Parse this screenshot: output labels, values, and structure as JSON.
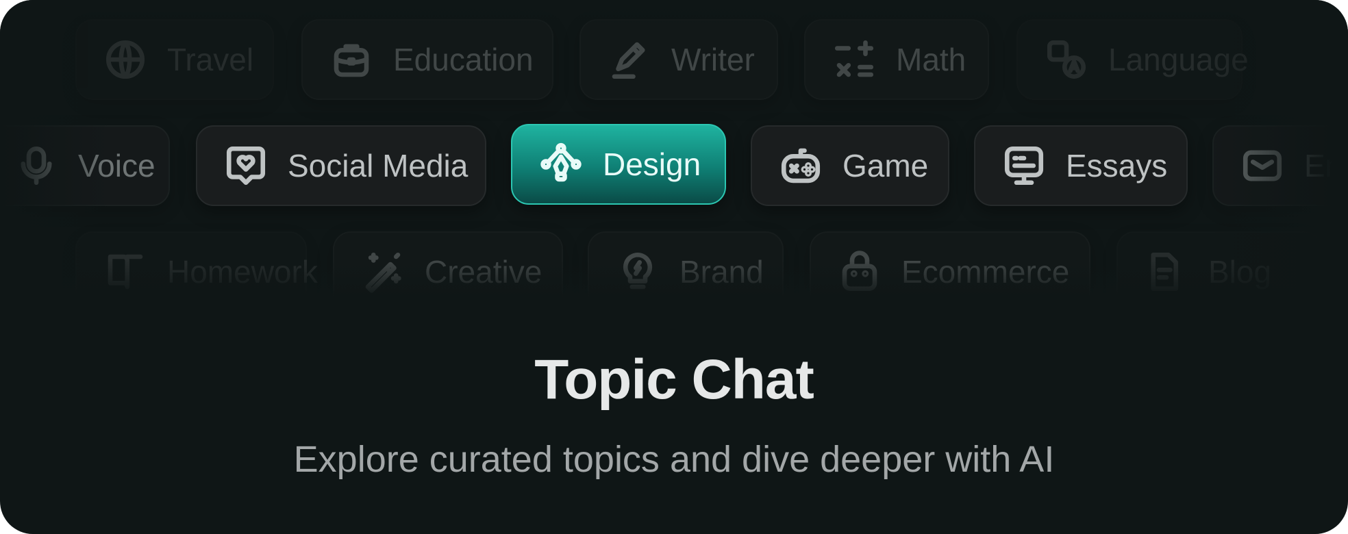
{
  "chips": {
    "row1": [
      {
        "label": "Travel",
        "icon": "globe-icon"
      },
      {
        "label": "Education",
        "icon": "briefcase-icon"
      },
      {
        "label": "Writer",
        "icon": "pencil-icon"
      },
      {
        "label": "Math",
        "icon": "math-symbols-icon"
      },
      {
        "label": "Language",
        "icon": "translate-icon"
      }
    ],
    "row2": [
      {
        "label": "Voice",
        "icon": "microphone-icon"
      },
      {
        "label": "Social Media",
        "icon": "heart-bubble-icon"
      },
      {
        "label": "Design",
        "icon": "pen-tool-icon",
        "active": true
      },
      {
        "label": "Game",
        "icon": "gamepad-icon"
      },
      {
        "label": "Essays",
        "icon": "document-lines-icon"
      },
      {
        "label": "Email",
        "icon": "mail-icon"
      }
    ],
    "row3": [
      {
        "label": "Homework",
        "icon": "book-icon"
      },
      {
        "label": "Creative",
        "icon": "magic-wand-icon"
      },
      {
        "label": "Brand",
        "icon": "lightbulb-icon"
      },
      {
        "label": "Ecommerce",
        "icon": "shopping-bag-icon"
      },
      {
        "label": "Blog",
        "icon": "blog-icon"
      }
    ]
  },
  "hero": {
    "title": "Topic Chat",
    "subtitle": "Explore curated topics and dive deeper with AI"
  },
  "colors": {
    "background": "#0f1616",
    "accent": "#1fb3a0"
  }
}
